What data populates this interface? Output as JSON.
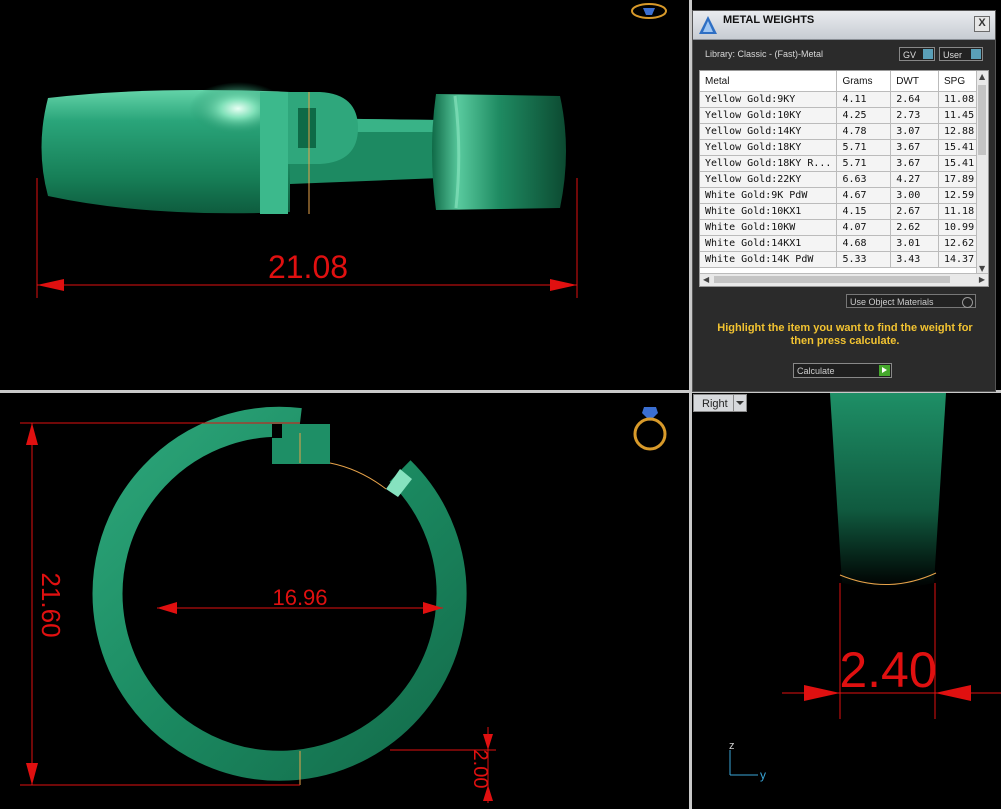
{
  "top_viewport": {
    "dimension": "21.08"
  },
  "bottom_viewport": {
    "dimension_height": "21.60",
    "dimension_inner": "16.96",
    "dimension_thickness": "2.00"
  },
  "right_viewport": {
    "label": "Right",
    "dimension": "2.40",
    "axis_z": "z",
    "axis_y": "y"
  },
  "panel": {
    "title": "METAL WEIGHTS",
    "close_label": "X",
    "library": "Library: Classic - (Fast)-Metal",
    "toggle_gv": "GV",
    "toggle_user": "User",
    "columns": [
      "Metal",
      "Grams",
      "DWT",
      "SPG"
    ],
    "rows": [
      [
        "Yellow Gold:9KY",
        "4.11",
        "2.64",
        "11.08"
      ],
      [
        "Yellow Gold:10KY",
        "4.25",
        "2.73",
        "11.45"
      ],
      [
        "Yellow Gold:14KY",
        "4.78",
        "3.07",
        "12.88"
      ],
      [
        "Yellow Gold:18KY",
        "5.71",
        "3.67",
        "15.41"
      ],
      [
        "Yellow Gold:18KY R...",
        "5.71",
        "3.67",
        "15.41"
      ],
      [
        "Yellow Gold:22KY",
        "6.63",
        "4.27",
        "17.89"
      ],
      [
        "White Gold:9K PdW",
        "4.67",
        "3.00",
        "12.59"
      ],
      [
        "White Gold:10KX1",
        "4.15",
        "2.67",
        "11.18"
      ],
      [
        "White Gold:10KW",
        "4.07",
        "2.62",
        "10.99"
      ],
      [
        "White Gold:14KX1",
        "4.68",
        "3.01",
        "12.62"
      ],
      [
        "White Gold:14K PdW",
        "5.33",
        "3.43",
        "14.37"
      ]
    ],
    "use_object_materials": "Use Object Materials",
    "hint": "Highlight the item you want to find the weight for then press calculate.",
    "calculate_label": "Calculate"
  },
  "colors": {
    "ring": "#1e8f66",
    "dimension": "#e01010",
    "hint": "#f2c331"
  }
}
